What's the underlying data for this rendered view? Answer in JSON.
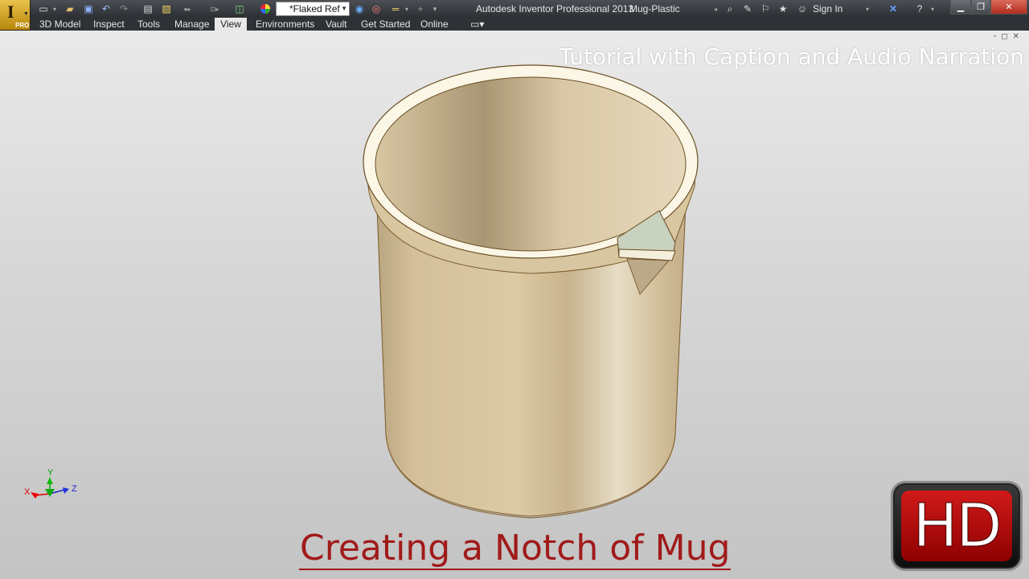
{
  "titlebar": {
    "app_logo_letter": "I",
    "app_logo_badge": "PRO",
    "appearance_value": "*Flaked Ref",
    "app_name": "Autodesk Inventor Professional 2013",
    "document_name": "Mug-Plastic",
    "signin_label": "Sign In"
  },
  "ribbon": {
    "tabs": [
      {
        "label": "3D Model",
        "active": false
      },
      {
        "label": "Inspect",
        "active": false
      },
      {
        "label": "Tools",
        "active": false
      },
      {
        "label": "Manage",
        "active": false
      },
      {
        "label": "View",
        "active": true
      },
      {
        "label": "Environments",
        "active": false
      },
      {
        "label": "Vault",
        "active": false
      },
      {
        "label": "Get Started",
        "active": false
      },
      {
        "label": "Online",
        "active": false
      }
    ]
  },
  "viewport": {
    "caption_top": "Tutorial with Caption and Audio Narration",
    "caption_bottom": "Creating a Notch of Mug",
    "triad": {
      "x": "X",
      "y": "Y",
      "z": "Z"
    },
    "hd_badge": "HD"
  },
  "colors": {
    "mug_body": "#d6c4a0",
    "mug_rim": "#fbf6e6",
    "caption_red": "#a11a1a",
    "hd_red": "#c41010"
  }
}
